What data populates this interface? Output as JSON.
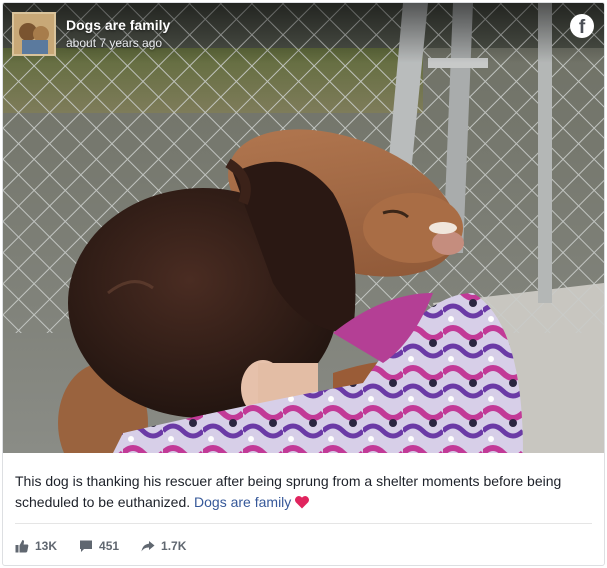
{
  "post": {
    "page_name": "Dogs are family",
    "timestamp": "about 7 years ago",
    "platform_icon": "facebook-icon",
    "photo": "girl-hugging-dog-photo",
    "caption": {
      "text": "This dog is thanking his rescuer after being sprung from a shelter moments before being scheduled to be euthanized.",
      "link_text": "Dogs are family",
      "emoji": "red-heart-icon"
    },
    "stats": {
      "likes": "13K",
      "comments": "451",
      "shares": "1.7K"
    }
  },
  "colors": {
    "link": "#365899",
    "text": "#1d2129",
    "stat_text": "#606770",
    "heart": "#e0245e",
    "border": "#dddfe2"
  }
}
